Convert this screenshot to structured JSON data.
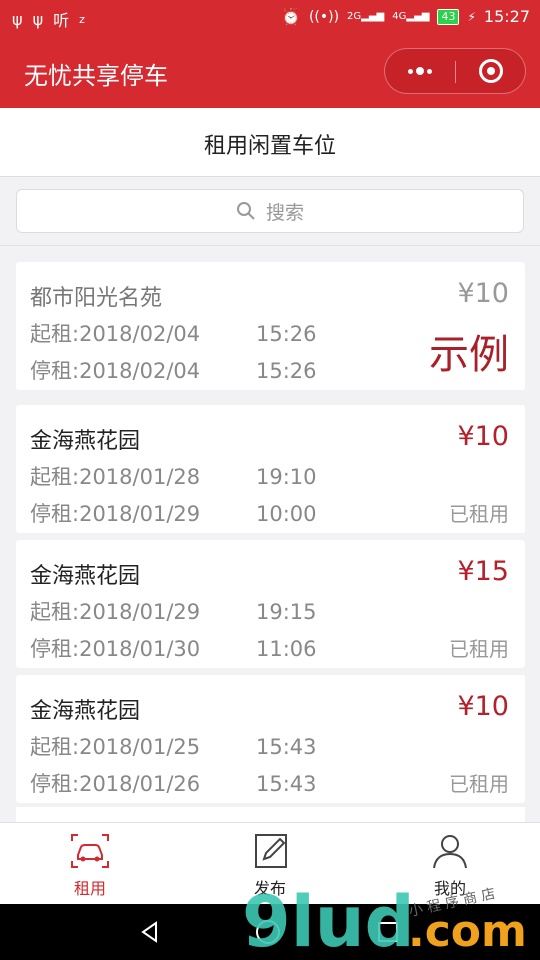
{
  "status_bar": {
    "left_text": "听",
    "network_labels": [
      "2G",
      "4G",
      "2G"
    ],
    "battery": "43",
    "time": "15:27"
  },
  "app_bar": {
    "title": "无忧共享停车",
    "more_icon": "more-dots-icon",
    "close_icon": "target-icon"
  },
  "page": {
    "title": "租用闲置车位"
  },
  "search": {
    "placeholder": "搜索"
  },
  "colors": {
    "brand_red": "#d42a30",
    "price_red": "#b5202a",
    "example_gray": "#999999"
  },
  "listings": [
    {
      "name": "都市阳光名苑",
      "price": "¥10",
      "start_label": "起租:",
      "start_date": "2018/02/04",
      "start_time": "15:26",
      "end_label": "停租:",
      "end_date": "2018/02/04",
      "end_time": "15:26",
      "status": "",
      "mark": "示例"
    },
    {
      "name": "金海燕花园",
      "price": "¥10",
      "start_label": "起租:",
      "start_date": "2018/01/28",
      "start_time": "19:10",
      "end_label": "停租:",
      "end_date": "2018/01/29",
      "end_time": "10:00",
      "status": "已租用"
    },
    {
      "name": "金海燕花园",
      "price": "¥15",
      "start_label": "起租:",
      "start_date": "2018/01/29",
      "start_time": "19:15",
      "end_label": "停租:",
      "end_date": "2018/01/30",
      "end_time": "11:06",
      "status": "已租用"
    },
    {
      "name": "金海燕花园",
      "price": "¥10",
      "start_label": "起租:",
      "start_date": "2018/01/25",
      "start_time": "15:43",
      "end_label": "停租:",
      "end_date": "2018/01/26",
      "end_time": "15:43",
      "status": "已租用"
    }
  ],
  "tabbar": {
    "tabs": [
      {
        "label": "租用",
        "icon": "car-icon",
        "active": true
      },
      {
        "label": "发布",
        "icon": "edit-icon",
        "active": false
      },
      {
        "label": "我的",
        "icon": "user-icon",
        "active": false
      }
    ]
  },
  "watermark": {
    "text": "9lud.com",
    "subtext": "小程序商店"
  }
}
